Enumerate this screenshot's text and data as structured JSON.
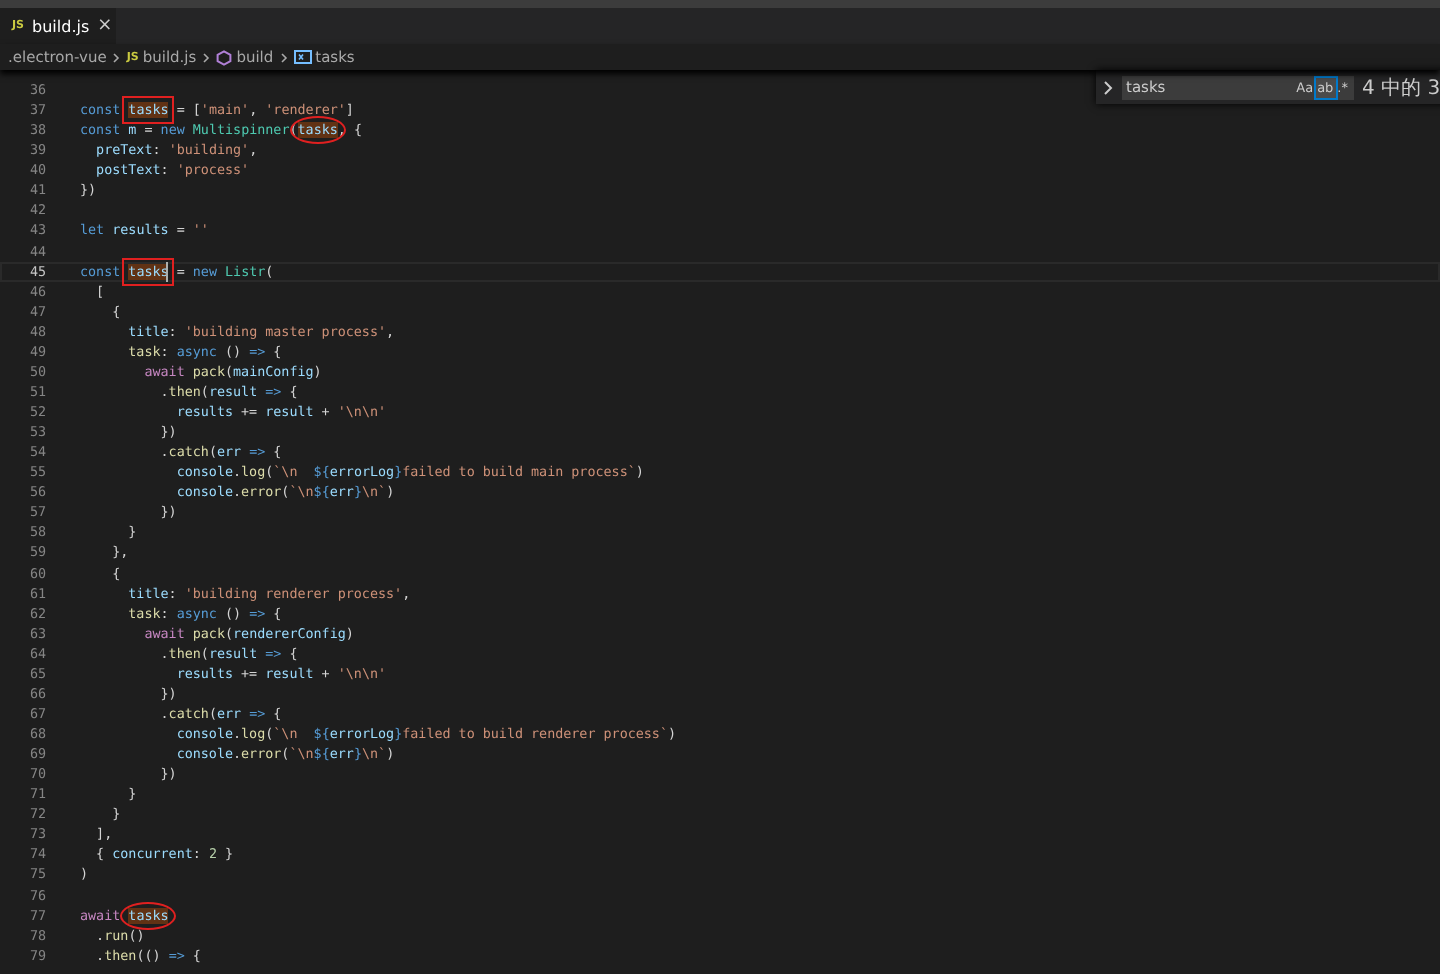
{
  "tabs": [
    {
      "icon_text": "JS",
      "label": "build.js",
      "close": "×",
      "selected": true
    }
  ],
  "breadcrumb": [
    {
      "kind": "folder",
      "label": ".electron-vue"
    },
    {
      "kind": "file",
      "icon_text": "JS",
      "label": "build.js"
    },
    {
      "kind": "function",
      "label": "build"
    },
    {
      "kind": "variable",
      "label": "tasks"
    }
  ],
  "find_widget": {
    "value": "tasks",
    "options": [
      {
        "label": "Aa",
        "selected": false
      },
      {
        "label": "ab",
        "selected": true
      },
      {
        "label": ".*",
        "selected": false
      }
    ],
    "count": "4 中的 3"
  },
  "lines": [
    {
      "number": "36",
      "current": false
    },
    {
      "number": "37",
      "current": false,
      "tokens": [
        {
          "kind": "kw",
          "text": "const "
        },
        {
          "kind": "match",
          "text": "tasks",
          "annotation": {
            "kind": "box"
          }
        },
        {
          "kind": "plain",
          "text": " = ["
        },
        {
          "kind": "str",
          "text": "'main'"
        },
        {
          "kind": "plain",
          "text": ", "
        },
        {
          "kind": "str",
          "text": "'renderer'"
        },
        {
          "kind": "plain",
          "text": "]"
        }
      ]
    },
    {
      "number": "38",
      "current": false,
      "tokens": [
        {
          "kind": "kw",
          "text": "const "
        },
        {
          "kind": "var",
          "text": "m"
        },
        {
          "kind": "plain",
          "text": " = "
        },
        {
          "kind": "kw",
          "text": "new "
        },
        {
          "kind": "cls",
          "text": "Multispinner"
        },
        {
          "kind": "plain",
          "text": "("
        },
        {
          "kind": "match",
          "text": "tasks",
          "annotation": {
            "kind": "ellipse"
          }
        },
        {
          "kind": "plain",
          "text": ", {"
        }
      ]
    },
    {
      "number": "39",
      "current": false,
      "tokens": [
        {
          "kind": "var",
          "text": "  preText"
        },
        {
          "kind": "plain",
          "text": ": "
        },
        {
          "kind": "str",
          "text": "'building'"
        },
        {
          "kind": "plain",
          "text": ","
        }
      ]
    },
    {
      "number": "40",
      "current": false,
      "tokens": [
        {
          "kind": "var",
          "text": "  postText"
        },
        {
          "kind": "plain",
          "text": ": "
        },
        {
          "kind": "str",
          "text": "'process'"
        }
      ]
    },
    {
      "number": "41",
      "current": false,
      "tokens": [
        {
          "kind": "plain",
          "text": "})"
        }
      ]
    },
    {
      "number": "42",
      "current": false
    },
    {
      "number": "43",
      "current": false,
      "tokens": [
        {
          "kind": "kw",
          "text": "let "
        },
        {
          "kind": "var",
          "text": "results"
        },
        {
          "kind": "plain",
          "text": " = "
        },
        {
          "kind": "str",
          "text": "''"
        }
      ]
    },
    {
      "number": "44",
      "current": false
    },
    {
      "number": "45",
      "current": true,
      "tokens": [
        {
          "kind": "kw",
          "text": "const "
        },
        {
          "kind": "match",
          "text": "tasks",
          "annotation": {
            "kind": "box"
          },
          "cursor": true
        },
        {
          "kind": "plain",
          "text": " = "
        },
        {
          "kind": "kw",
          "text": "new "
        },
        {
          "kind": "cls",
          "text": "Listr"
        },
        {
          "kind": "plain",
          "text": "("
        }
      ]
    },
    {
      "number": "46",
      "current": false,
      "tokens": [
        {
          "kind": "plain",
          "text": "  ["
        }
      ]
    },
    {
      "number": "47",
      "current": false,
      "tokens": [
        {
          "kind": "plain",
          "text": "    {"
        }
      ]
    },
    {
      "number": "48",
      "current": false,
      "tokens": [
        {
          "kind": "var",
          "text": "      title"
        },
        {
          "kind": "plain",
          "text": ": "
        },
        {
          "kind": "str",
          "text": "'building master process'"
        },
        {
          "kind": "plain",
          "text": ","
        }
      ]
    },
    {
      "number": "49",
      "current": false,
      "tokens": [
        {
          "kind": "fn",
          "text": "      task"
        },
        {
          "kind": "plain",
          "text": ": "
        },
        {
          "kind": "kw",
          "text": "async"
        },
        {
          "kind": "plain",
          "text": " () "
        },
        {
          "kind": "kw",
          "text": "=>"
        },
        {
          "kind": "plain",
          "text": " {"
        }
      ]
    },
    {
      "number": "50",
      "current": false,
      "tokens": [
        {
          "kind": "ctl",
          "text": "        await "
        },
        {
          "kind": "fn",
          "text": "pack"
        },
        {
          "kind": "plain",
          "text": "("
        },
        {
          "kind": "var",
          "text": "mainConfig"
        },
        {
          "kind": "plain",
          "text": ")"
        }
      ]
    },
    {
      "number": "51",
      "current": false,
      "tokens": [
        {
          "kind": "plain",
          "text": "          ."
        },
        {
          "kind": "fn",
          "text": "then"
        },
        {
          "kind": "plain",
          "text": "("
        },
        {
          "kind": "var",
          "text": "result"
        },
        {
          "kind": "kw",
          "text": " =>"
        },
        {
          "kind": "plain",
          "text": " {"
        }
      ]
    },
    {
      "number": "52",
      "current": false,
      "tokens": [
        {
          "kind": "var",
          "text": "            results"
        },
        {
          "kind": "plain",
          "text": " += "
        },
        {
          "kind": "var",
          "text": "result"
        },
        {
          "kind": "plain",
          "text": " + "
        },
        {
          "kind": "str",
          "text": "'\\n\\n'"
        }
      ]
    },
    {
      "number": "53",
      "current": false,
      "tokens": [
        {
          "kind": "plain",
          "text": "          })"
        }
      ]
    },
    {
      "number": "54",
      "current": false,
      "tokens": [
        {
          "kind": "plain",
          "text": "          ."
        },
        {
          "kind": "fn",
          "text": "catch"
        },
        {
          "kind": "plain",
          "text": "("
        },
        {
          "kind": "var",
          "text": "err"
        },
        {
          "kind": "kw",
          "text": " =>"
        },
        {
          "kind": "plain",
          "text": " {"
        }
      ]
    },
    {
      "number": "55",
      "current": false,
      "tokens": [
        {
          "kind": "var",
          "text": "            console"
        },
        {
          "kind": "plain",
          "text": "."
        },
        {
          "kind": "fn",
          "text": "log"
        },
        {
          "kind": "plain",
          "text": "("
        },
        {
          "kind": "str",
          "text": "`\\n  "
        },
        {
          "kind": "kw",
          "text": "${"
        },
        {
          "kind": "var",
          "text": "errorLog"
        },
        {
          "kind": "kw",
          "text": "}"
        },
        {
          "kind": "str",
          "text": "failed to build main process`"
        },
        {
          "kind": "plain",
          "text": ")"
        }
      ]
    },
    {
      "number": "56",
      "current": false,
      "tokens": [
        {
          "kind": "var",
          "text": "            console"
        },
        {
          "kind": "plain",
          "text": "."
        },
        {
          "kind": "fn",
          "text": "error"
        },
        {
          "kind": "plain",
          "text": "("
        },
        {
          "kind": "str",
          "text": "`\\n"
        },
        {
          "kind": "kw",
          "text": "${"
        },
        {
          "kind": "var",
          "text": "err"
        },
        {
          "kind": "kw",
          "text": "}"
        },
        {
          "kind": "str",
          "text": "\\n`"
        },
        {
          "kind": "plain",
          "text": ")"
        }
      ]
    },
    {
      "number": "57",
      "current": false,
      "tokens": [
        {
          "kind": "plain",
          "text": "          })"
        }
      ]
    },
    {
      "number": "58",
      "current": false,
      "tokens": [
        {
          "kind": "plain",
          "text": "      }"
        }
      ]
    },
    {
      "number": "59",
      "current": false,
      "tokens": [
        {
          "kind": "plain",
          "text": "    },"
        }
      ]
    },
    {
      "number": "60",
      "current": false,
      "tokens": [
        {
          "kind": "plain",
          "text": "    {"
        }
      ]
    },
    {
      "number": "61",
      "current": false,
      "tokens": [
        {
          "kind": "var",
          "text": "      title"
        },
        {
          "kind": "plain",
          "text": ": "
        },
        {
          "kind": "str",
          "text": "'building renderer process'"
        },
        {
          "kind": "plain",
          "text": ","
        }
      ]
    },
    {
      "number": "62",
      "current": false,
      "tokens": [
        {
          "kind": "fn",
          "text": "      task"
        },
        {
          "kind": "plain",
          "text": ": "
        },
        {
          "kind": "kw",
          "text": "async"
        },
        {
          "kind": "plain",
          "text": " () "
        },
        {
          "kind": "kw",
          "text": "=>"
        },
        {
          "kind": "plain",
          "text": " {"
        }
      ]
    },
    {
      "number": "63",
      "current": false,
      "tokens": [
        {
          "kind": "ctl",
          "text": "        await "
        },
        {
          "kind": "fn",
          "text": "pack"
        },
        {
          "kind": "plain",
          "text": "("
        },
        {
          "kind": "var",
          "text": "rendererConfig"
        },
        {
          "kind": "plain",
          "text": ")"
        }
      ]
    },
    {
      "number": "64",
      "current": false,
      "tokens": [
        {
          "kind": "plain",
          "text": "          ."
        },
        {
          "kind": "fn",
          "text": "then"
        },
        {
          "kind": "plain",
          "text": "("
        },
        {
          "kind": "var",
          "text": "result"
        },
        {
          "kind": "kw",
          "text": " =>"
        },
        {
          "kind": "plain",
          "text": " {"
        }
      ]
    },
    {
      "number": "65",
      "current": false,
      "tokens": [
        {
          "kind": "var",
          "text": "            results"
        },
        {
          "kind": "plain",
          "text": " += "
        },
        {
          "kind": "var",
          "text": "result"
        },
        {
          "kind": "plain",
          "text": " + "
        },
        {
          "kind": "str",
          "text": "'\\n\\n'"
        }
      ]
    },
    {
      "number": "66",
      "current": false,
      "tokens": [
        {
          "kind": "plain",
          "text": "          })"
        }
      ]
    },
    {
      "number": "67",
      "current": false,
      "tokens": [
        {
          "kind": "plain",
          "text": "          ."
        },
        {
          "kind": "fn",
          "text": "catch"
        },
        {
          "kind": "plain",
          "text": "("
        },
        {
          "kind": "var",
          "text": "err"
        },
        {
          "kind": "kw",
          "text": " =>"
        },
        {
          "kind": "plain",
          "text": " {"
        }
      ]
    },
    {
      "number": "68",
      "current": false,
      "tokens": [
        {
          "kind": "var",
          "text": "            console"
        },
        {
          "kind": "plain",
          "text": "."
        },
        {
          "kind": "fn",
          "text": "log"
        },
        {
          "kind": "plain",
          "text": "("
        },
        {
          "kind": "str",
          "text": "`\\n  "
        },
        {
          "kind": "kw",
          "text": "${"
        },
        {
          "kind": "var",
          "text": "errorLog"
        },
        {
          "kind": "kw",
          "text": "}"
        },
        {
          "kind": "str",
          "text": "failed to build renderer process`"
        },
        {
          "kind": "plain",
          "text": ")"
        }
      ]
    },
    {
      "number": "69",
      "current": false,
      "tokens": [
        {
          "kind": "var",
          "text": "            console"
        },
        {
          "kind": "plain",
          "text": "."
        },
        {
          "kind": "fn",
          "text": "error"
        },
        {
          "kind": "plain",
          "text": "("
        },
        {
          "kind": "str",
          "text": "`\\n"
        },
        {
          "kind": "kw",
          "text": "${"
        },
        {
          "kind": "var",
          "text": "err"
        },
        {
          "kind": "kw",
          "text": "}"
        },
        {
          "kind": "str",
          "text": "\\n`"
        },
        {
          "kind": "plain",
          "text": ")"
        }
      ]
    },
    {
      "number": "70",
      "current": false,
      "tokens": [
        {
          "kind": "plain",
          "text": "          })"
        }
      ]
    },
    {
      "number": "71",
      "current": false,
      "tokens": [
        {
          "kind": "plain",
          "text": "      }"
        }
      ]
    },
    {
      "number": "72",
      "current": false,
      "tokens": [
        {
          "kind": "plain",
          "text": "    }"
        }
      ]
    },
    {
      "number": "73",
      "current": false,
      "tokens": [
        {
          "kind": "plain",
          "text": "  ],"
        }
      ]
    },
    {
      "number": "74",
      "current": false,
      "tokens": [
        {
          "kind": "plain",
          "text": "  { "
        },
        {
          "kind": "var",
          "text": "concurrent"
        },
        {
          "kind": "plain",
          "text": ": "
        },
        {
          "kind": "num",
          "text": "2"
        },
        {
          "kind": "plain",
          "text": " }"
        }
      ]
    },
    {
      "number": "75",
      "current": false,
      "tokens": [
        {
          "kind": "plain",
          "text": ")"
        }
      ]
    },
    {
      "number": "76",
      "current": false
    },
    {
      "number": "77",
      "current": false,
      "tokens": [
        {
          "kind": "ctl",
          "text": "await "
        },
        {
          "kind": "match",
          "text": "tasks",
          "annotation": {
            "kind": "ellipse"
          }
        }
      ]
    },
    {
      "number": "78",
      "current": false,
      "tokens": [
        {
          "kind": "plain",
          "text": "  ."
        },
        {
          "kind": "fn",
          "text": "run"
        },
        {
          "kind": "plain",
          "text": "()"
        }
      ]
    },
    {
      "number": "79",
      "current": false,
      "tokens": [
        {
          "kind": "plain",
          "text": "  ."
        },
        {
          "kind": "fn",
          "text": "then"
        },
        {
          "kind": "plain",
          "text": "(() "
        },
        {
          "kind": "kw",
          "text": "=>"
        },
        {
          "kind": "plain",
          "text": " {"
        }
      ]
    }
  ]
}
